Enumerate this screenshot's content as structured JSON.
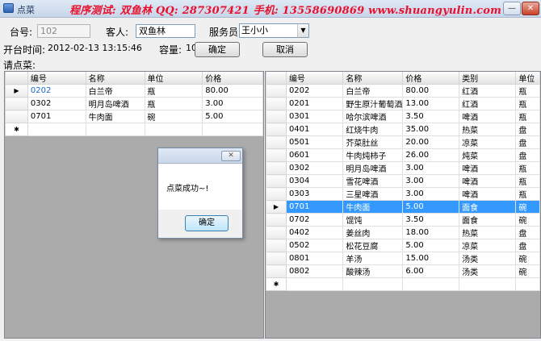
{
  "window": {
    "title": "点菜",
    "banner": "程序测试: 双鱼林   QQ: 287307421   手机: 13558690869   www.shuangyulin.com",
    "minimize_glyph": "—",
    "close_glyph": "✕"
  },
  "form": {
    "table_label": "台号:",
    "table_value": "102",
    "guest_label": "客人:",
    "guest_value": "双鱼林",
    "waiter_label": "服务员:",
    "waiter_value": "王小小",
    "open_time_label": "开台时间:",
    "open_time_value": "2012-02-13 13:15:46",
    "capacity_label": "容量:",
    "capacity_value": "10",
    "confirm_label": "确定",
    "cancel_label": "取消",
    "order_label": "请点菜:"
  },
  "ordered_grid": {
    "columns": [
      "编号",
      "名称",
      "单位",
      "价格"
    ],
    "rows": [
      {
        "code": "0202",
        "name": "白兰帝",
        "unit": "瓶",
        "price": "80.00",
        "current": true
      },
      {
        "code": "0302",
        "name": "明月岛啤酒",
        "unit": "瓶",
        "price": "3.00"
      },
      {
        "code": "0701",
        "name": "牛肉面",
        "unit": "碗",
        "price": "5.00"
      }
    ],
    "current_marker": "▶",
    "new_row_marker": "✱"
  },
  "menu_grid": {
    "columns": [
      "编号",
      "名称",
      "价格",
      "类别",
      "单位"
    ],
    "rows": [
      {
        "code": "0202",
        "name": "白兰帝",
        "price": "80.00",
        "category": "红酒",
        "unit": "瓶"
      },
      {
        "code": "0201",
        "name": "野生原汁葡萄酒",
        "price": "13.00",
        "category": "红酒",
        "unit": "瓶"
      },
      {
        "code": "0301",
        "name": "哈尔滨啤酒",
        "price": "3.50",
        "category": "啤酒",
        "unit": "瓶"
      },
      {
        "code": "0401",
        "name": "红烧牛肉",
        "price": "35.00",
        "category": "热菜",
        "unit": "盘"
      },
      {
        "code": "0501",
        "name": "芥菜肚丝",
        "price": "20.00",
        "category": "凉菜",
        "unit": "盘"
      },
      {
        "code": "0601",
        "name": "牛肉炖柿子",
        "price": "26.00",
        "category": "炖菜",
        "unit": "盘"
      },
      {
        "code": "0302",
        "name": "明月岛啤酒",
        "price": "3.00",
        "category": "啤酒",
        "unit": "瓶"
      },
      {
        "code": "0304",
        "name": "雪花啤酒",
        "price": "3.00",
        "category": "啤酒",
        "unit": "瓶"
      },
      {
        "code": "0303",
        "name": "三星啤酒",
        "price": "3.00",
        "category": "啤酒",
        "unit": "瓶"
      },
      {
        "code": "0701",
        "name": "牛肉面",
        "price": "5.00",
        "category": "面食",
        "unit": "碗",
        "selected": true
      },
      {
        "code": "0702",
        "name": "馄饨",
        "price": "3.50",
        "category": "面食",
        "unit": "碗"
      },
      {
        "code": "0402",
        "name": "姜丝肉",
        "price": "18.00",
        "category": "热菜",
        "unit": "盘"
      },
      {
        "code": "0502",
        "name": "松花豆腐",
        "price": "5.00",
        "category": "凉菜",
        "unit": "盘"
      },
      {
        "code": "0801",
        "name": "羊汤",
        "price": "15.00",
        "category": "汤类",
        "unit": "碗"
      },
      {
        "code": "0802",
        "name": "酸辣汤",
        "price": "6.00",
        "category": "汤类",
        "unit": "碗"
      }
    ],
    "current_marker": "▶",
    "new_row_marker": "✱"
  },
  "dialog": {
    "message": "点菜成功~!",
    "ok_label": "确定",
    "close_glyph": "✕"
  },
  "colors": {
    "banner": "#e8112d",
    "selection": "#3399ff",
    "grid_background": "#ababab"
  }
}
